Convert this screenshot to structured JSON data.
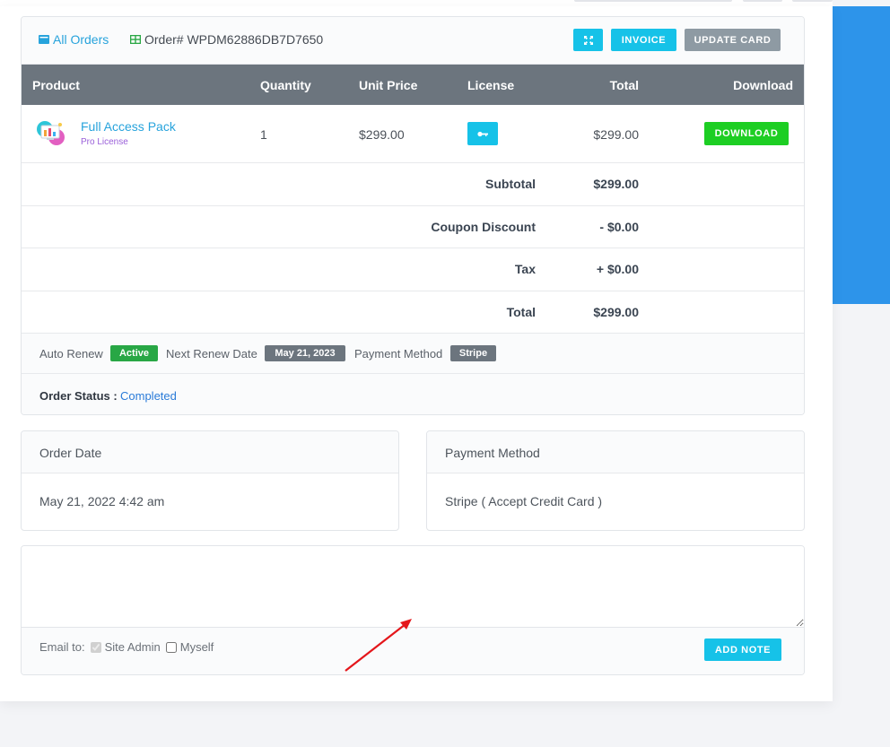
{
  "breadcrumb": {
    "all_orders": "All Orders",
    "order_id": "Order# WPDM62886DB7D7650"
  },
  "toolbar": {
    "invoice_label": "INVOICE",
    "update_card_label": "UPDATE CARD"
  },
  "table": {
    "headers": [
      "Product",
      "Quantity",
      "Unit Price",
      "License",
      "Total",
      "Download"
    ],
    "rows": [
      {
        "product": "Full Access Pack",
        "license_name": "Pro License",
        "quantity": "1",
        "unit_price": "$299.00",
        "total": "$299.00",
        "download_label": "DOWNLOAD"
      }
    ]
  },
  "summary": [
    {
      "label": "Subtotal",
      "value": "$299.00"
    },
    {
      "label": "Coupon Discount",
      "value": "- $0.00"
    },
    {
      "label": "Tax",
      "value": "+ $0.00"
    },
    {
      "label": "Total",
      "value": "$299.00"
    }
  ],
  "meta": {
    "auto_renew_label": "Auto Renew",
    "auto_renew_value": "Active",
    "next_renew_label": "Next Renew Date",
    "next_renew_value": "May 21, 2023",
    "payment_method_label": "Payment Method",
    "payment_method_value": "Stripe"
  },
  "status": {
    "label": "Order Status :",
    "value": "Completed"
  },
  "order_date": {
    "title": "Order Date",
    "value": "May 21, 2022 4:42 am"
  },
  "payment": {
    "title": "Payment Method",
    "value": "Stripe ( Accept Credit Card )"
  },
  "note": {
    "placeholder": "",
    "email_to_label": "Email to:",
    "site_admin_label": "Site Admin",
    "myself_label": "Myself",
    "add_note_label": "ADD NOTE"
  },
  "colors": {
    "accent": "#16c2e8",
    "link": "#27a3dc",
    "header_bg": "#6c757e",
    "active_badge": "#28a745",
    "download": "#1dce23",
    "annotation_arrow": "#e4161b"
  },
  "icons": [
    "wallet-icon",
    "grid-icon",
    "expand-icon",
    "key-icon",
    "product-thumbnail",
    "arrow-annotation"
  ]
}
